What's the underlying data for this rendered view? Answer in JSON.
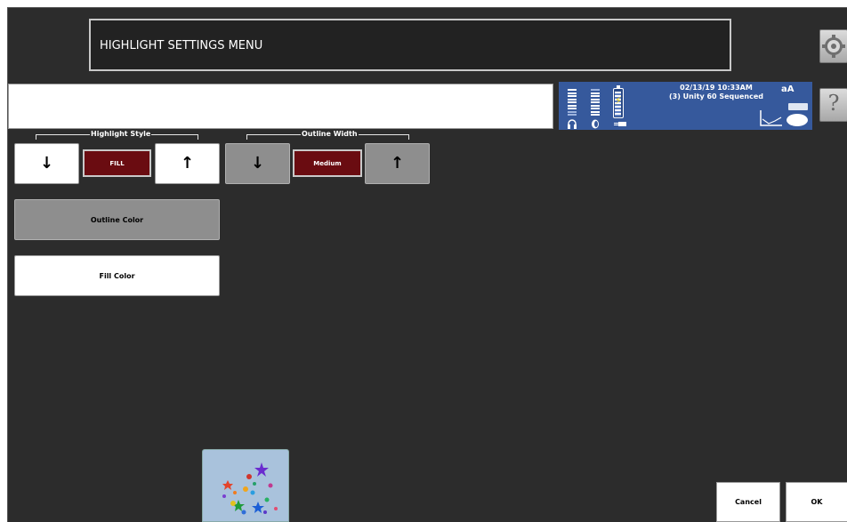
{
  "title": "HIGHLIGHT SETTINGS MENU",
  "toolbar": {
    "settings_icon": "gear-icon",
    "help_label": "?"
  },
  "status": {
    "date_time": "02/13/19 10:33AM",
    "mode": "(3) Unity 60 Sequenced",
    "text_size_label": "aA",
    "icons": [
      "headphones-icon",
      "speaker-icon",
      "battery-icon",
      "plug-icon",
      "text-size-icon",
      "keyboard-icon",
      "graph-icon",
      "speech-icon"
    ]
  },
  "highlight_style": {
    "label": "Highlight Style",
    "value": "FILL",
    "down_glyph": "↓",
    "up_glyph": "↑"
  },
  "outline_width": {
    "label": "Outline Width",
    "value": "Medium",
    "down_glyph": "↓",
    "up_glyph": "↑"
  },
  "buttons": {
    "outline_color": "Outline Color",
    "fill_color": "Fill Color",
    "cancel": "Cancel",
    "ok": "OK"
  },
  "colors": {
    "background": "#2c2c2c",
    "value_box": "#6a0c11",
    "status_bar": "#36599c",
    "disabled_button": "#8e8e8e"
  }
}
